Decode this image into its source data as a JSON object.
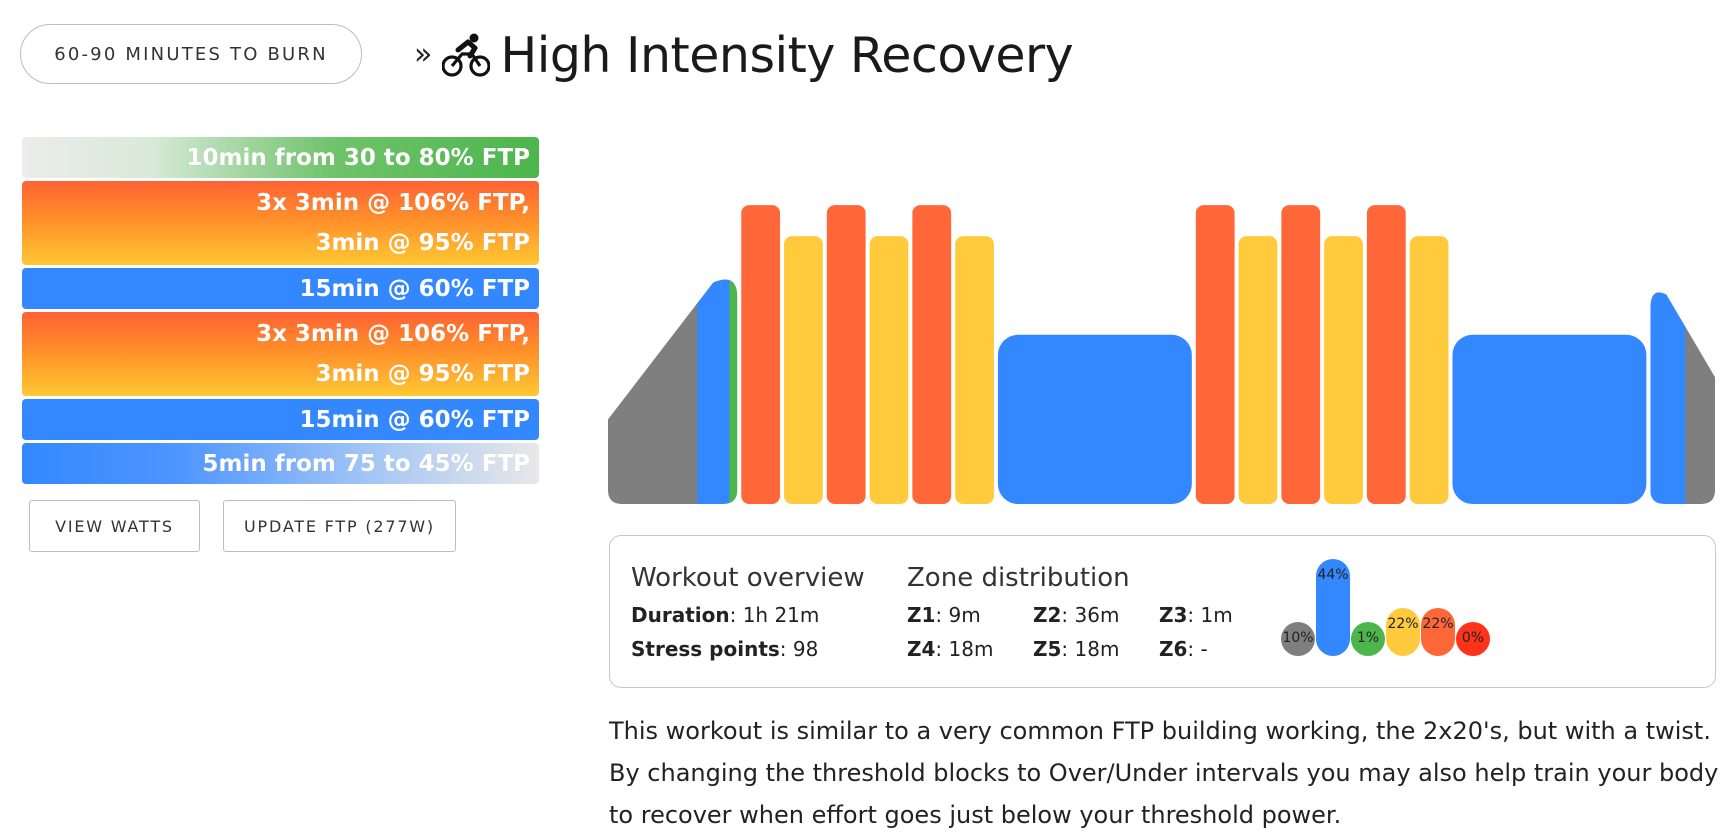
{
  "header": {
    "time_pill": "60-90 MINUTES TO BURN",
    "chevron": "»",
    "title": "High Intensity Recovery"
  },
  "segments": [
    {
      "lines": [
        "10min from 30 to 80% FTP"
      ],
      "kind": "warmup"
    },
    {
      "lines": [
        "3x 3min @ 106% FTP,",
        "3min @ 95% FTP"
      ],
      "kind": "overunder"
    },
    {
      "lines": [
        "15min @ 60% FTP"
      ],
      "kind": "steady"
    },
    {
      "lines": [
        "3x 3min @ 106% FTP,",
        "3min @ 95% FTP"
      ],
      "kind": "overunder"
    },
    {
      "lines": [
        "15min @ 60% FTP"
      ],
      "kind": "steady"
    },
    {
      "lines": [
        "5min from 75 to 45% FTP"
      ],
      "kind": "cooldown"
    }
  ],
  "buttons": {
    "view_watts": "VIEW WATTS",
    "update_ftp": "UPDATE FTP (277W)"
  },
  "overview": {
    "heading": "Workout overview",
    "duration_label": "Duration",
    "duration_value": "1h 21m",
    "stress_label": "Stress points",
    "stress_value": "98"
  },
  "zones": {
    "heading": "Zone distribution",
    "items": [
      {
        "label": "Z1",
        "value": "9m"
      },
      {
        "label": "Z2",
        "value": "36m"
      },
      {
        "label": "Z3",
        "value": "1m"
      },
      {
        "label": "Z4",
        "value": "18m"
      },
      {
        "label": "Z5",
        "value": "18m"
      },
      {
        "label": "Z6",
        "value": "-"
      }
    ],
    "bars": [
      {
        "pct": 10,
        "label": "10%",
        "color": "#7f7f7f"
      },
      {
        "pct": 44,
        "label": "44%",
        "color": "#3388ff"
      },
      {
        "pct": 1,
        "label": "1%",
        "color": "#4cb64c"
      },
      {
        "pct": 22,
        "label": "22%",
        "color": "#ffcb3d"
      },
      {
        "pct": 22,
        "label": "22%",
        "color": "#ff6638"
      },
      {
        "pct": 0,
        "label": "0%",
        "color": "#ff3319"
      }
    ]
  },
  "description": "This workout is similar to a very common FTP building working, the 2x20's, but with a twist. By changing the threshold blocks to Over/Under intervals you may also help train your body to recover when effort goes just below your threshold power.",
  "colors": {
    "z1": "#7f7f7f",
    "z2": "#3388ff",
    "z3": "#4cb64c",
    "z4": "#ffcb3d",
    "z5": "#ff6638",
    "z6": "#ff3319"
  },
  "chart_data": {
    "type": "bar",
    "x_unit": "minutes",
    "y_unit": "% FTP",
    "blocks": [
      {
        "minutes": 10,
        "from": 30,
        "to": 80,
        "zones": [
          "#7f7f7f",
          "#3388ff",
          "#4cb64c"
        ]
      },
      {
        "minutes": 3,
        "power": 106,
        "zone": "#ff6638"
      },
      {
        "minutes": 3,
        "power": 95,
        "zone": "#ffcb3d"
      },
      {
        "minutes": 3,
        "power": 106,
        "zone": "#ff6638"
      },
      {
        "minutes": 3,
        "power": 95,
        "zone": "#ffcb3d"
      },
      {
        "minutes": 3,
        "power": 106,
        "zone": "#ff6638"
      },
      {
        "minutes": 3,
        "power": 95,
        "zone": "#ffcb3d"
      },
      {
        "minutes": 15,
        "power": 60,
        "zone": "#3388ff"
      },
      {
        "minutes": 3,
        "power": 106,
        "zone": "#ff6638"
      },
      {
        "minutes": 3,
        "power": 95,
        "zone": "#ffcb3d"
      },
      {
        "minutes": 3,
        "power": 106,
        "zone": "#ff6638"
      },
      {
        "minutes": 3,
        "power": 95,
        "zone": "#ffcb3d"
      },
      {
        "minutes": 3,
        "power": 106,
        "zone": "#ff6638"
      },
      {
        "minutes": 3,
        "power": 95,
        "zone": "#ffcb3d"
      },
      {
        "minutes": 15,
        "power": 60,
        "zone": "#3388ff"
      },
      {
        "minutes": 5,
        "from": 75,
        "to": 45,
        "zones": [
          "#3388ff",
          "#7f7f7f"
        ]
      }
    ]
  }
}
